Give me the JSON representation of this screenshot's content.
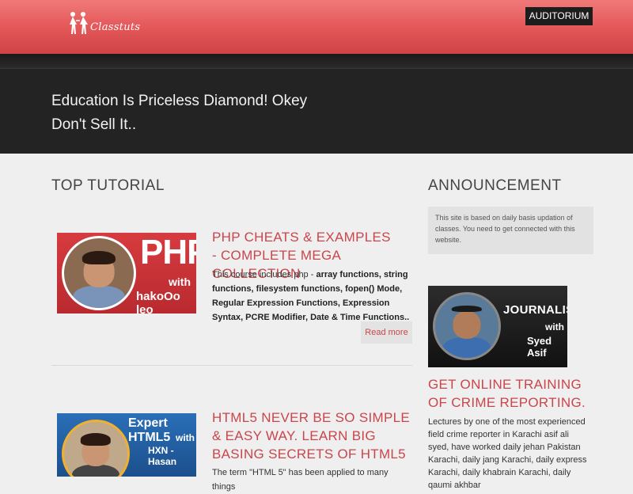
{
  "header": {
    "logo_text": "Classtuts",
    "auditorium_label": "AUDITORIUM",
    "colors": {
      "topbar": "#e4585a",
      "dark": "#232323",
      "accent": "#c9464b"
    }
  },
  "hero": {
    "line1": "Education Is Priceless Diamond! Okey",
    "line2": "Don't Sell It.."
  },
  "top_tutorial": {
    "title": "TOP TUTORIAL",
    "posts": [
      {
        "thumb": {
          "big": "PHP",
          "with": "with",
          "name": "hakoOo leo"
        },
        "title": "PHP CHEATS & EXAMPLES - COMPLETE MEGA COLLECTION",
        "intro": "This course includes php - ",
        "body_bold": "array functions, string functions, filesystem functions, fopen() Mode, Regular Expression Functions, Expression Syntax, PCRE Modifier, Date & Time Functions..",
        "readmore": "Read more"
      },
      {
        "thumb": {
          "big": "Expert HTML5",
          "with": "with",
          "name": "HXN - Hasan"
        },
        "title": "HTML5 NEVER BE SO SIMPLE & EASY WAY. LEARN BIG BASING SECRETS OF HTML5",
        "body": "The term \"HTML 5\" has been applied to many things"
      }
    ]
  },
  "announcement": {
    "title": "ANNOUNCEMENT",
    "box_text": "This site is based on daily basis updation of classes. You need to get connected with this website.",
    "feature": {
      "thumb": {
        "big": "JOURNALISIM",
        "with": "with",
        "name": "Syed Asif"
      },
      "title": "GET ONLINE TRAINING OF CRIME REPORTING.",
      "body": "Lectures by one of the most experienced field crime reporter in Karachi asif ali syed, have worked daily jehan Pakistan Karachi, daily jang Karachi, daily express Karachi, daily khabrain Karachi, daily qaumi akhbar"
    }
  }
}
